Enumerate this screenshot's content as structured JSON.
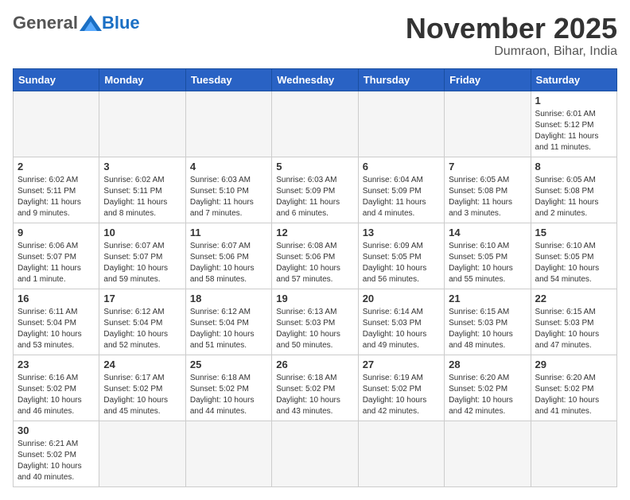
{
  "header": {
    "logo_general": "General",
    "logo_blue": "Blue",
    "month_title": "November 2025",
    "location": "Dumraon, Bihar, India"
  },
  "weekdays": [
    "Sunday",
    "Monday",
    "Tuesday",
    "Wednesday",
    "Thursday",
    "Friday",
    "Saturday"
  ],
  "days": [
    {
      "date": 1,
      "sunrise": "6:01 AM",
      "sunset": "5:12 PM",
      "daylight": "11 hours and 11 minutes."
    },
    {
      "date": 2,
      "sunrise": "6:02 AM",
      "sunset": "5:11 PM",
      "daylight": "11 hours and 9 minutes."
    },
    {
      "date": 3,
      "sunrise": "6:02 AM",
      "sunset": "5:11 PM",
      "daylight": "11 hours and 8 minutes."
    },
    {
      "date": 4,
      "sunrise": "6:03 AM",
      "sunset": "5:10 PM",
      "daylight": "11 hours and 7 minutes."
    },
    {
      "date": 5,
      "sunrise": "6:03 AM",
      "sunset": "5:09 PM",
      "daylight": "11 hours and 6 minutes."
    },
    {
      "date": 6,
      "sunrise": "6:04 AM",
      "sunset": "5:09 PM",
      "daylight": "11 hours and 4 minutes."
    },
    {
      "date": 7,
      "sunrise": "6:05 AM",
      "sunset": "5:08 PM",
      "daylight": "11 hours and 3 minutes."
    },
    {
      "date": 8,
      "sunrise": "6:05 AM",
      "sunset": "5:08 PM",
      "daylight": "11 hours and 2 minutes."
    },
    {
      "date": 9,
      "sunrise": "6:06 AM",
      "sunset": "5:07 PM",
      "daylight": "11 hours and 1 minute."
    },
    {
      "date": 10,
      "sunrise": "6:07 AM",
      "sunset": "5:07 PM",
      "daylight": "10 hours and 59 minutes."
    },
    {
      "date": 11,
      "sunrise": "6:07 AM",
      "sunset": "5:06 PM",
      "daylight": "10 hours and 58 minutes."
    },
    {
      "date": 12,
      "sunrise": "6:08 AM",
      "sunset": "5:06 PM",
      "daylight": "10 hours and 57 minutes."
    },
    {
      "date": 13,
      "sunrise": "6:09 AM",
      "sunset": "5:05 PM",
      "daylight": "10 hours and 56 minutes."
    },
    {
      "date": 14,
      "sunrise": "6:10 AM",
      "sunset": "5:05 PM",
      "daylight": "10 hours and 55 minutes."
    },
    {
      "date": 15,
      "sunrise": "6:10 AM",
      "sunset": "5:05 PM",
      "daylight": "10 hours and 54 minutes."
    },
    {
      "date": 16,
      "sunrise": "6:11 AM",
      "sunset": "5:04 PM",
      "daylight": "10 hours and 53 minutes."
    },
    {
      "date": 17,
      "sunrise": "6:12 AM",
      "sunset": "5:04 PM",
      "daylight": "10 hours and 52 minutes."
    },
    {
      "date": 18,
      "sunrise": "6:12 AM",
      "sunset": "5:04 PM",
      "daylight": "10 hours and 51 minutes."
    },
    {
      "date": 19,
      "sunrise": "6:13 AM",
      "sunset": "5:03 PM",
      "daylight": "10 hours and 50 minutes."
    },
    {
      "date": 20,
      "sunrise": "6:14 AM",
      "sunset": "5:03 PM",
      "daylight": "10 hours and 49 minutes."
    },
    {
      "date": 21,
      "sunrise": "6:15 AM",
      "sunset": "5:03 PM",
      "daylight": "10 hours and 48 minutes."
    },
    {
      "date": 22,
      "sunrise": "6:15 AM",
      "sunset": "5:03 PM",
      "daylight": "10 hours and 47 minutes."
    },
    {
      "date": 23,
      "sunrise": "6:16 AM",
      "sunset": "5:02 PM",
      "daylight": "10 hours and 46 minutes."
    },
    {
      "date": 24,
      "sunrise": "6:17 AM",
      "sunset": "5:02 PM",
      "daylight": "10 hours and 45 minutes."
    },
    {
      "date": 25,
      "sunrise": "6:18 AM",
      "sunset": "5:02 PM",
      "daylight": "10 hours and 44 minutes."
    },
    {
      "date": 26,
      "sunrise": "6:18 AM",
      "sunset": "5:02 PM",
      "daylight": "10 hours and 43 minutes."
    },
    {
      "date": 27,
      "sunrise": "6:19 AM",
      "sunset": "5:02 PM",
      "daylight": "10 hours and 42 minutes."
    },
    {
      "date": 28,
      "sunrise": "6:20 AM",
      "sunset": "5:02 PM",
      "daylight": "10 hours and 42 minutes."
    },
    {
      "date": 29,
      "sunrise": "6:20 AM",
      "sunset": "5:02 PM",
      "daylight": "10 hours and 41 minutes."
    },
    {
      "date": 30,
      "sunrise": "6:21 AM",
      "sunset": "5:02 PM",
      "daylight": "10 hours and 40 minutes."
    }
  ]
}
